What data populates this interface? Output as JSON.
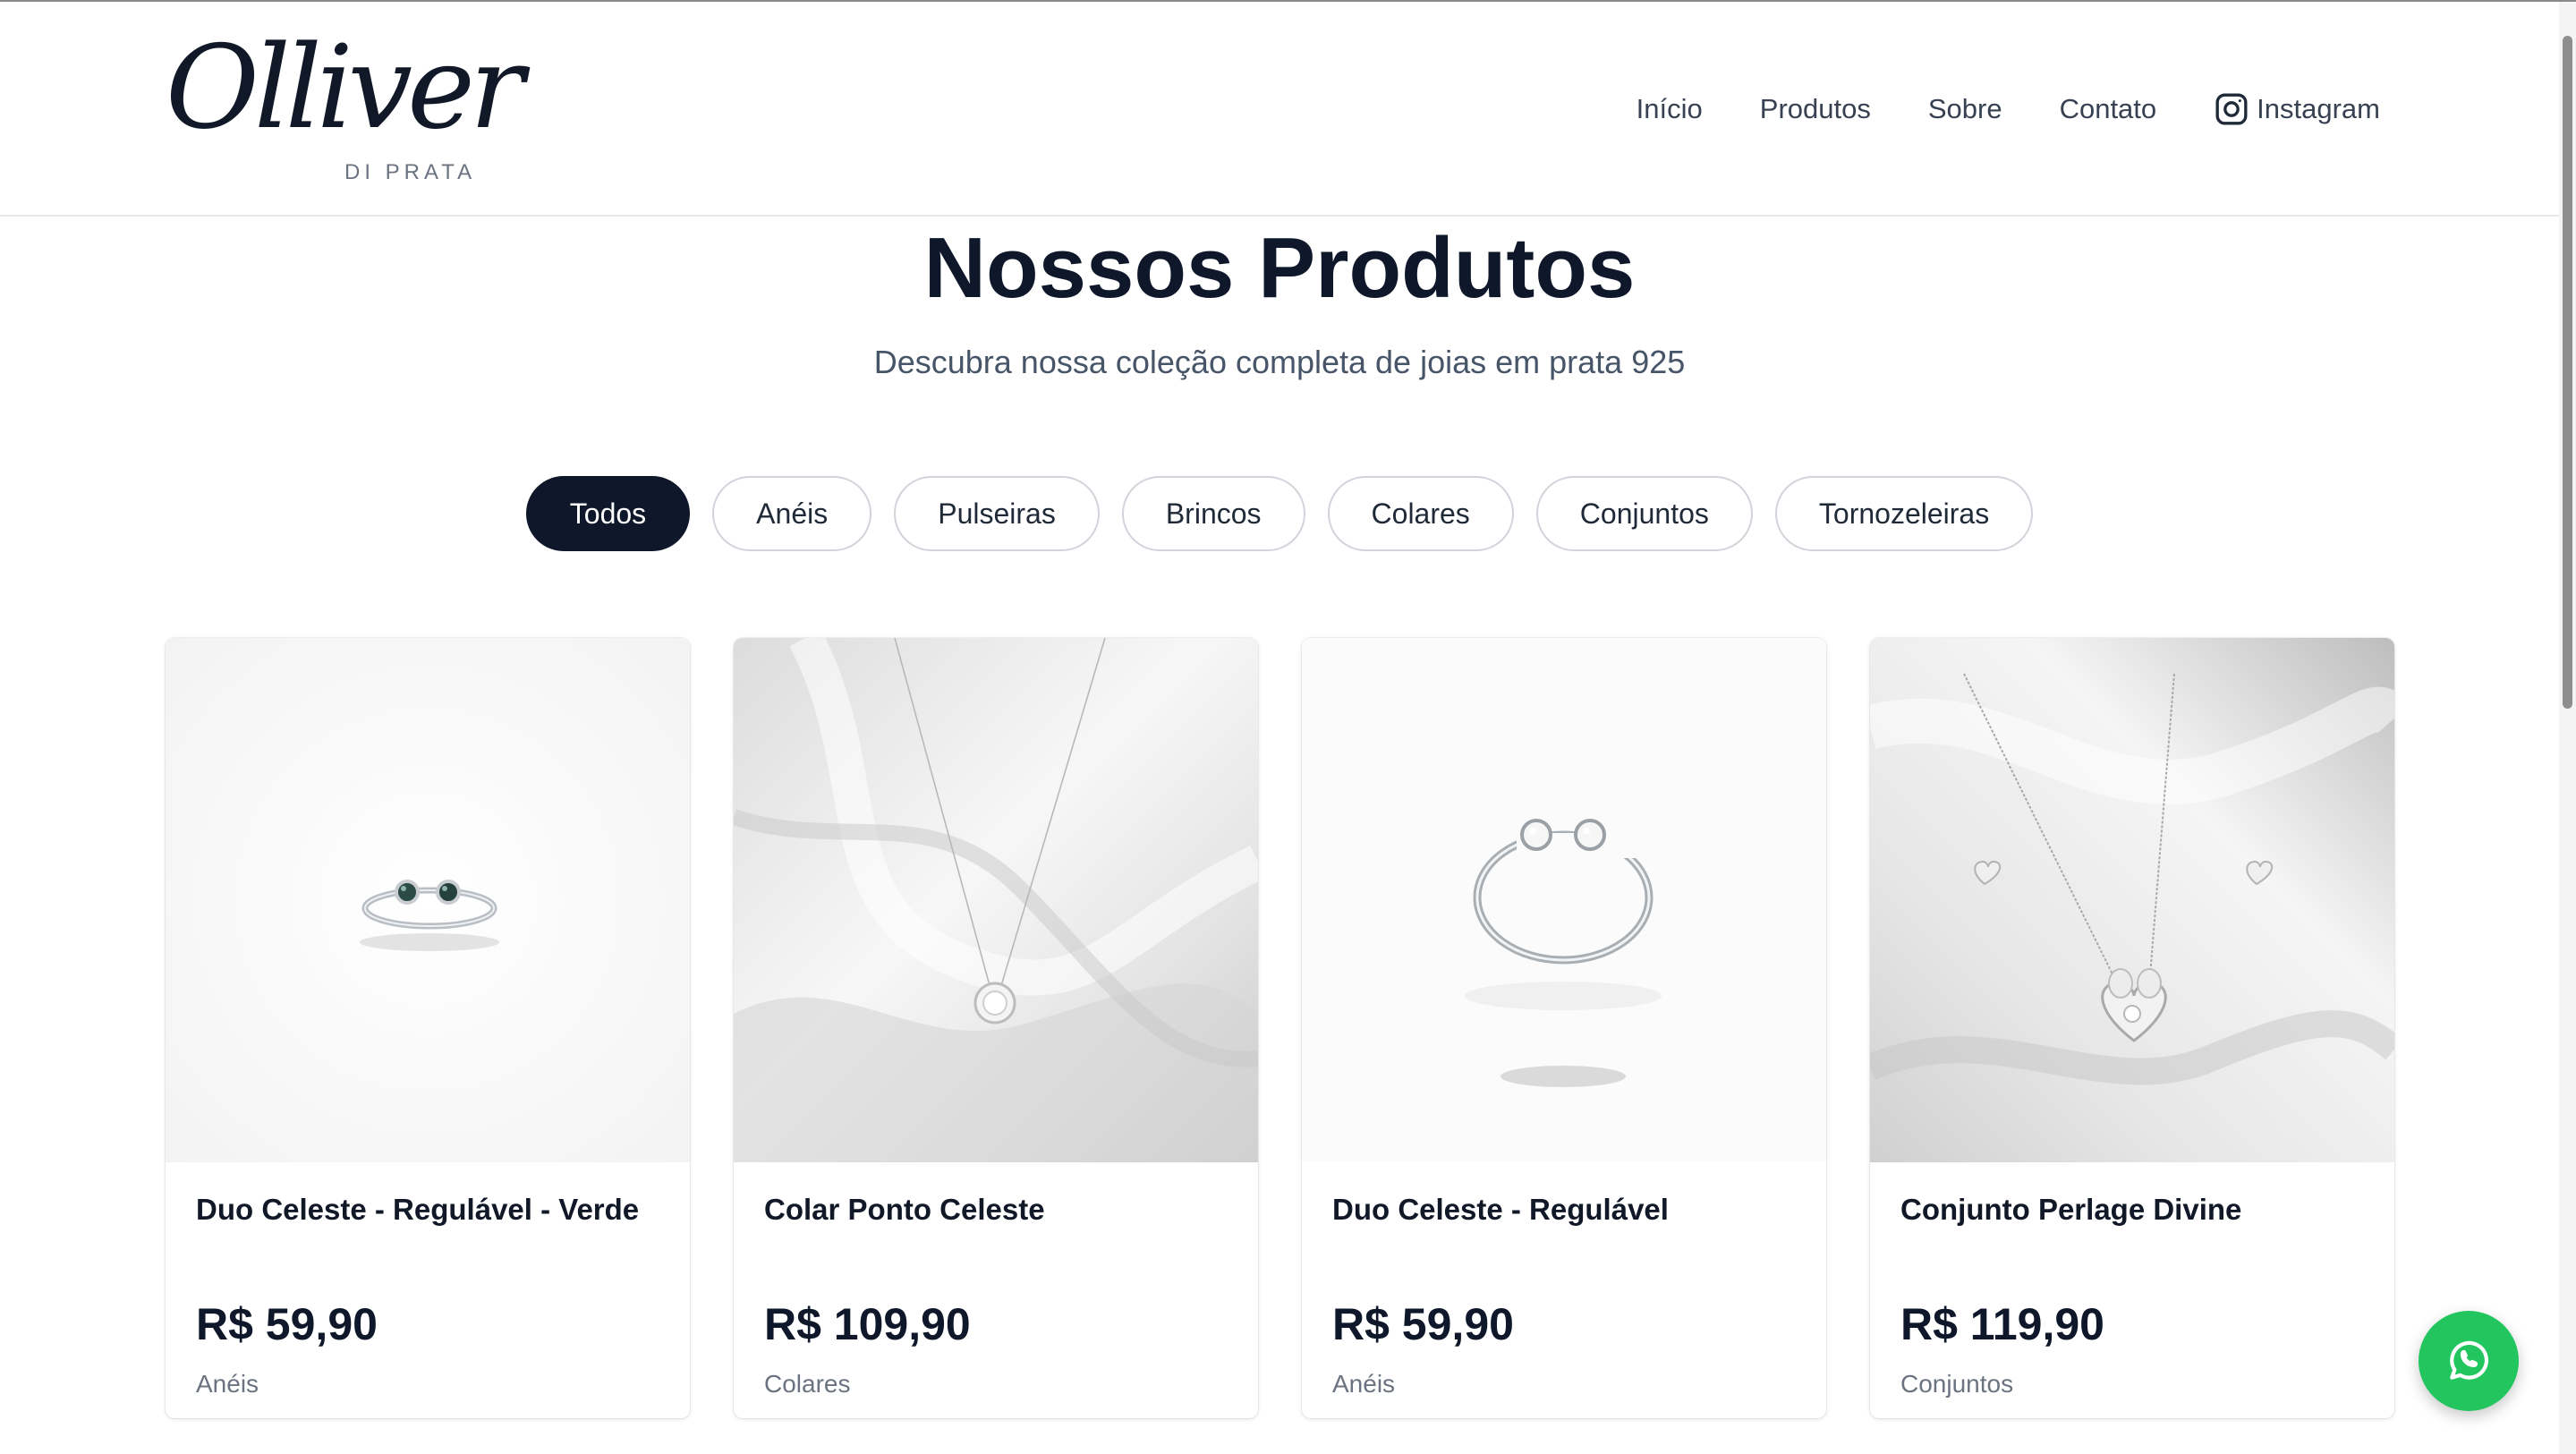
{
  "brand": {
    "logo_script": "Olliver",
    "logo_sub": "DI PRATA"
  },
  "nav": {
    "items": [
      {
        "label": "Início"
      },
      {
        "label": "Produtos"
      },
      {
        "label": "Sobre"
      },
      {
        "label": "Contato"
      }
    ],
    "instagram_label": "Instagram"
  },
  "page": {
    "title": "Nossos Produtos",
    "subtitle": "Descubra nossa coleção completa de joias em prata 925"
  },
  "filters": [
    {
      "label": "Todos",
      "active": true
    },
    {
      "label": "Anéis"
    },
    {
      "label": "Pulseiras"
    },
    {
      "label": "Brincos"
    },
    {
      "label": "Colares"
    },
    {
      "label": "Conjuntos"
    },
    {
      "label": "Tornozeleiras"
    }
  ],
  "products": [
    {
      "name": "Duo Celeste - Regulável - Verde",
      "price": "R$ 59,90",
      "category": "Anéis",
      "image": "ring-green-stones"
    },
    {
      "name": "Colar Ponto Celeste",
      "price": "R$ 109,90",
      "category": "Colares",
      "image": "necklace-satin"
    },
    {
      "name": "Duo Celeste - Regulável",
      "price": "R$ 59,90",
      "category": "Anéis",
      "image": "ring-clear-stones"
    },
    {
      "name": "Conjunto Perlage Divine",
      "price": "R$ 119,90",
      "category": "Conjuntos",
      "image": "set-heart-satin"
    }
  ],
  "colors": {
    "primary": "#0f172a",
    "whatsapp": "#22c55e",
    "border": "#d1d5db",
    "muted": "#6b7280"
  },
  "icons": {
    "instagram": "instagram-icon",
    "whatsapp": "whatsapp-icon"
  }
}
